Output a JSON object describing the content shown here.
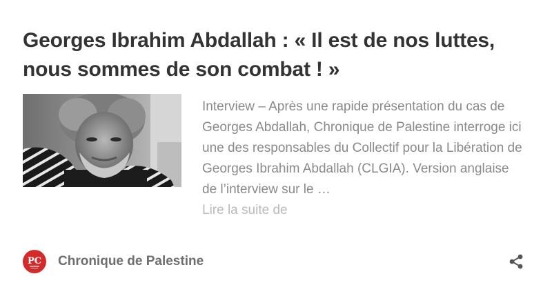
{
  "article": {
    "title": "Georges Ibrahim Abdallah : « Il est de nos luttes, nous sommes de son combat ! »",
    "excerpt": "Interview – Après une rapide présentation du cas de Georges Abdallah, Chronique de Palestine interroge ici une des responsables du Collectif pour la Libération de Georges Ibrahim Abdallah (CLGIA). Version anglaise de l’interview sur le …",
    "read_more": "Lire la suite de",
    "image_icon": "portrait-photo"
  },
  "source": {
    "name": "Chronique de Palestine",
    "logo_text": "PC",
    "logo_color": "#d42a2a",
    "logo_icon": "pc-logo-icon"
  },
  "actions": {
    "share_icon": "share-icon"
  },
  "colors": {
    "title": "#333333",
    "excerpt": "#8a8a8a",
    "read_more": "#b9b9b9",
    "source": "#6e6e6e",
    "icon": "#555555"
  }
}
